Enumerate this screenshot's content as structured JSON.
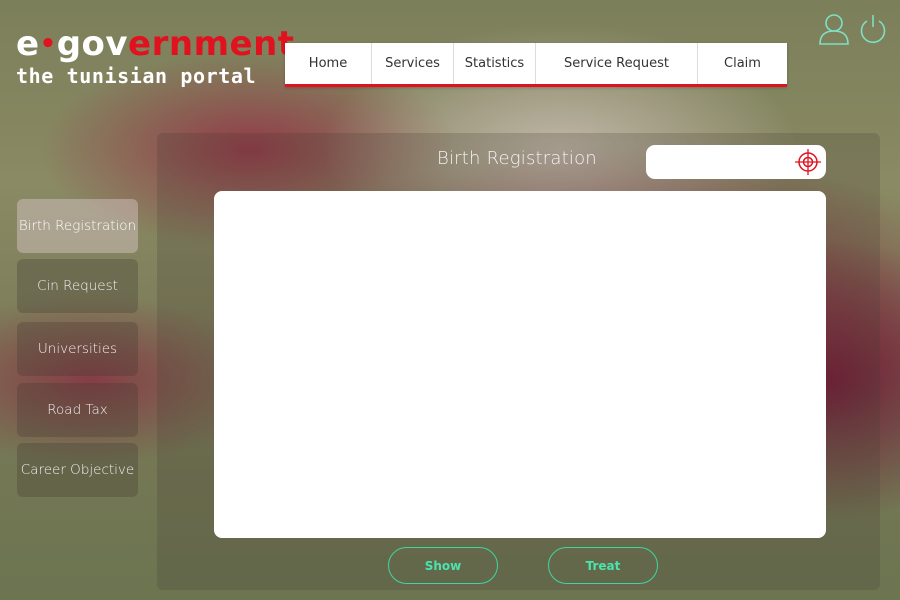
{
  "logo": {
    "e": "e",
    "dot": "•",
    "gov": "gov",
    "ernment": "ernment",
    "subtitle": "the tunisian portal"
  },
  "nav": {
    "items": [
      {
        "label": "Home"
      },
      {
        "label": "Services"
      },
      {
        "label": "Statistics"
      },
      {
        "label": "Service Request"
      },
      {
        "label": "Claim"
      }
    ]
  },
  "header_icons": [
    "user-icon",
    "power-icon"
  ],
  "sidebar": {
    "items": [
      {
        "label": "Birth Registration",
        "active": true
      },
      {
        "label": "Cin Request"
      },
      {
        "label": "Universities"
      },
      {
        "label": "Road Tax"
      },
      {
        "label": "Career Objective"
      }
    ]
  },
  "main": {
    "title": "Birth Registration",
    "search": {
      "value": "",
      "placeholder": "",
      "icon": "crosshair-target-icon"
    }
  },
  "actions": {
    "show_label": "Show",
    "treat_label": "Treat"
  },
  "colors": {
    "brand_red": "#e1121f",
    "accent_green": "#3fd6a2",
    "icon_green": "#7fe0c4"
  }
}
